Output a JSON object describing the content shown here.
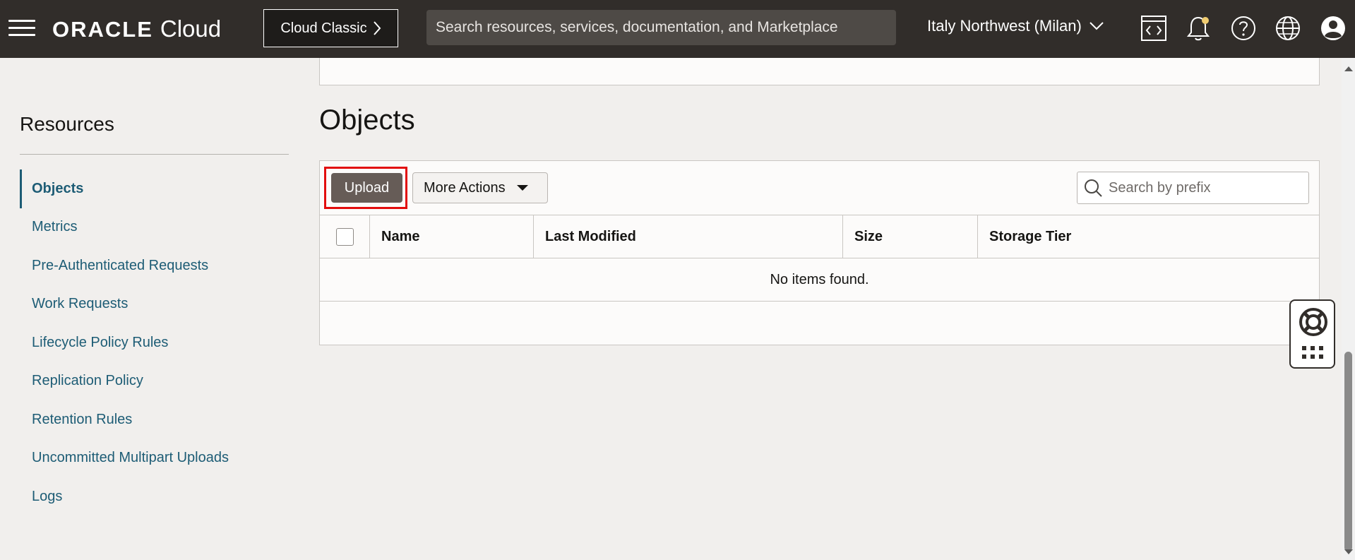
{
  "header": {
    "brand_oracle": "ORACLE",
    "brand_cloud": "Cloud",
    "classic_label": "Cloud Classic",
    "search_placeholder": "Search resources, services, documentation, and Marketplace",
    "region": "Italy Northwest (Milan)",
    "icons": [
      "hamburger-menu-icon",
      "code-editor-icon",
      "bell-icon",
      "help-icon",
      "globe-icon",
      "user-profile-icon"
    ],
    "bar_color": "#312d2a"
  },
  "sidebar": {
    "title": "Resources",
    "items": [
      {
        "label": "Objects",
        "active": true
      },
      {
        "label": "Metrics",
        "active": false
      },
      {
        "label": "Pre-Authenticated Requests",
        "active": false
      },
      {
        "label": "Work Requests",
        "active": false
      },
      {
        "label": "Lifecycle Policy Rules",
        "active": false
      },
      {
        "label": "Replication Policy",
        "active": false
      },
      {
        "label": "Retention Rules",
        "active": false
      },
      {
        "label": "Uncommitted Multipart Uploads",
        "active": false
      },
      {
        "label": "Logs",
        "active": false
      }
    ],
    "link_color": "#1d5c75"
  },
  "main": {
    "title": "Objects",
    "toolbar": {
      "upload_label": "Upload",
      "more_actions_label": "More Actions",
      "search_placeholder": "Search by prefix",
      "highlight_color": "#e20d0d"
    },
    "table": {
      "columns": [
        "Name",
        "Last Modified",
        "Size",
        "Storage Tier"
      ],
      "empty_message": "No items found."
    }
  },
  "help_widget": {
    "icons": [
      "lifebuoy-icon",
      "grid-dots-icon"
    ]
  }
}
